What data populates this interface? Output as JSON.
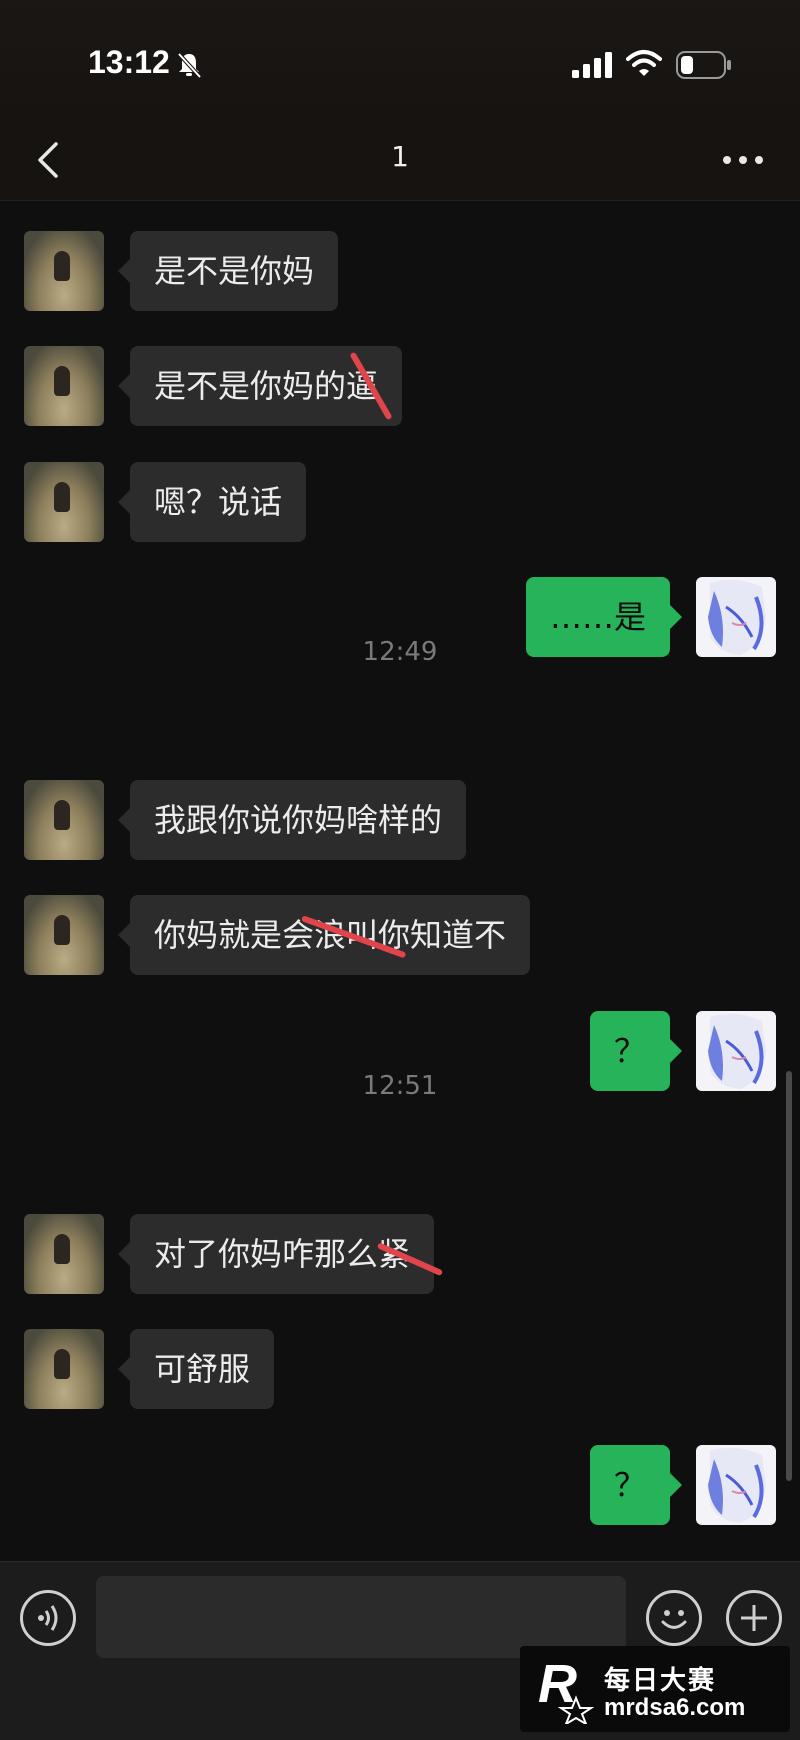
{
  "status": {
    "time": "13:12",
    "icons": [
      "bell-muted-icon",
      "signal-icon",
      "wifi-icon",
      "battery-icon"
    ]
  },
  "nav": {
    "back_icon": "chevron-left-icon",
    "title": "1",
    "more_icon": "more-dots-icon"
  },
  "messages": [
    {
      "from": "peer",
      "text": "是不是你妈"
    },
    {
      "from": "peer",
      "text": "是不是你妈的逼"
    },
    {
      "from": "peer",
      "text": "嗯？说话"
    },
    {
      "from": "self",
      "text": "……是"
    },
    {
      "from": "time",
      "text": "12:49"
    },
    {
      "from": "peer",
      "text": "我跟你说你妈啥样的"
    },
    {
      "from": "peer",
      "text": "你妈就是会浪叫你知道不"
    },
    {
      "from": "self",
      "text": "？"
    },
    {
      "from": "time",
      "text": "12:51"
    },
    {
      "from": "peer",
      "text": "对了你妈咋那么紧"
    },
    {
      "from": "peer",
      "text": "可舒服"
    },
    {
      "from": "self",
      "text": "？"
    }
  ],
  "input": {
    "voice_icon": "voice-icon",
    "emoji_icon": "emoji-icon",
    "plus_icon": "plus-icon",
    "placeholder": ""
  },
  "watermark": {
    "logo_text": "R",
    "name": "每日大赛",
    "domain": "mrdsa6.com"
  },
  "colors": {
    "background": "#0f0f0f",
    "peer_bubble": "#2c2c2c",
    "self_bubble": "#27b35a",
    "redaction": "#e0454b"
  }
}
